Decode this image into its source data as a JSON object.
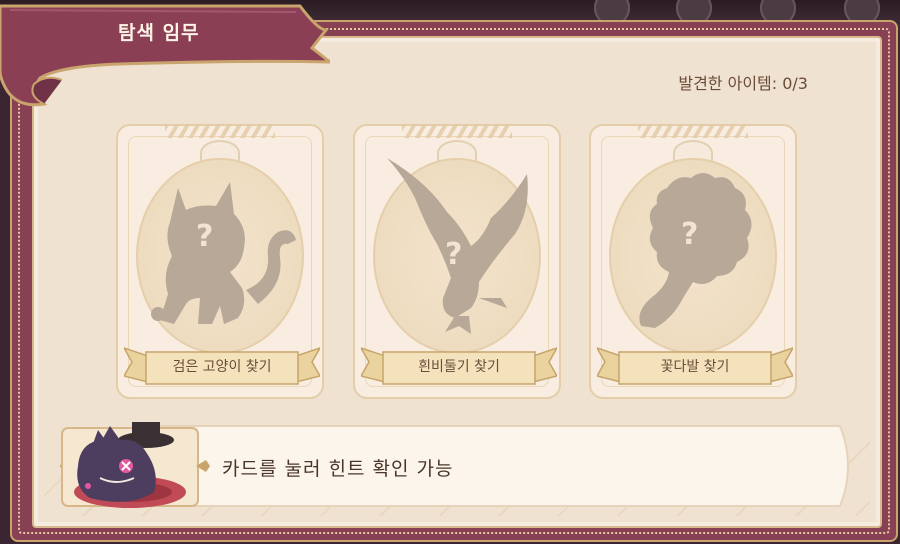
{
  "header": {
    "title": "탐색 임무",
    "found_label": "발견한 아이템: 0/3"
  },
  "cards": [
    {
      "label": "검은 고양이 찾기",
      "icon": "cat-silhouette-icon",
      "mark": "?"
    },
    {
      "label": "흰비둘기 찾기",
      "icon": "dove-silhouette-icon",
      "mark": "?"
    },
    {
      "label": "꽃다발 찾기",
      "icon": "bouquet-silhouette-icon",
      "mark": "?"
    }
  ],
  "hint": {
    "text": "카드를 눌러 힌트 확인 가능",
    "mascot": "purple-cat-mascot-icon"
  },
  "colors": {
    "frame": "#874054",
    "panel": "#efe2d1",
    "silhouette": "#b7a897",
    "text": "#6b4a36"
  }
}
